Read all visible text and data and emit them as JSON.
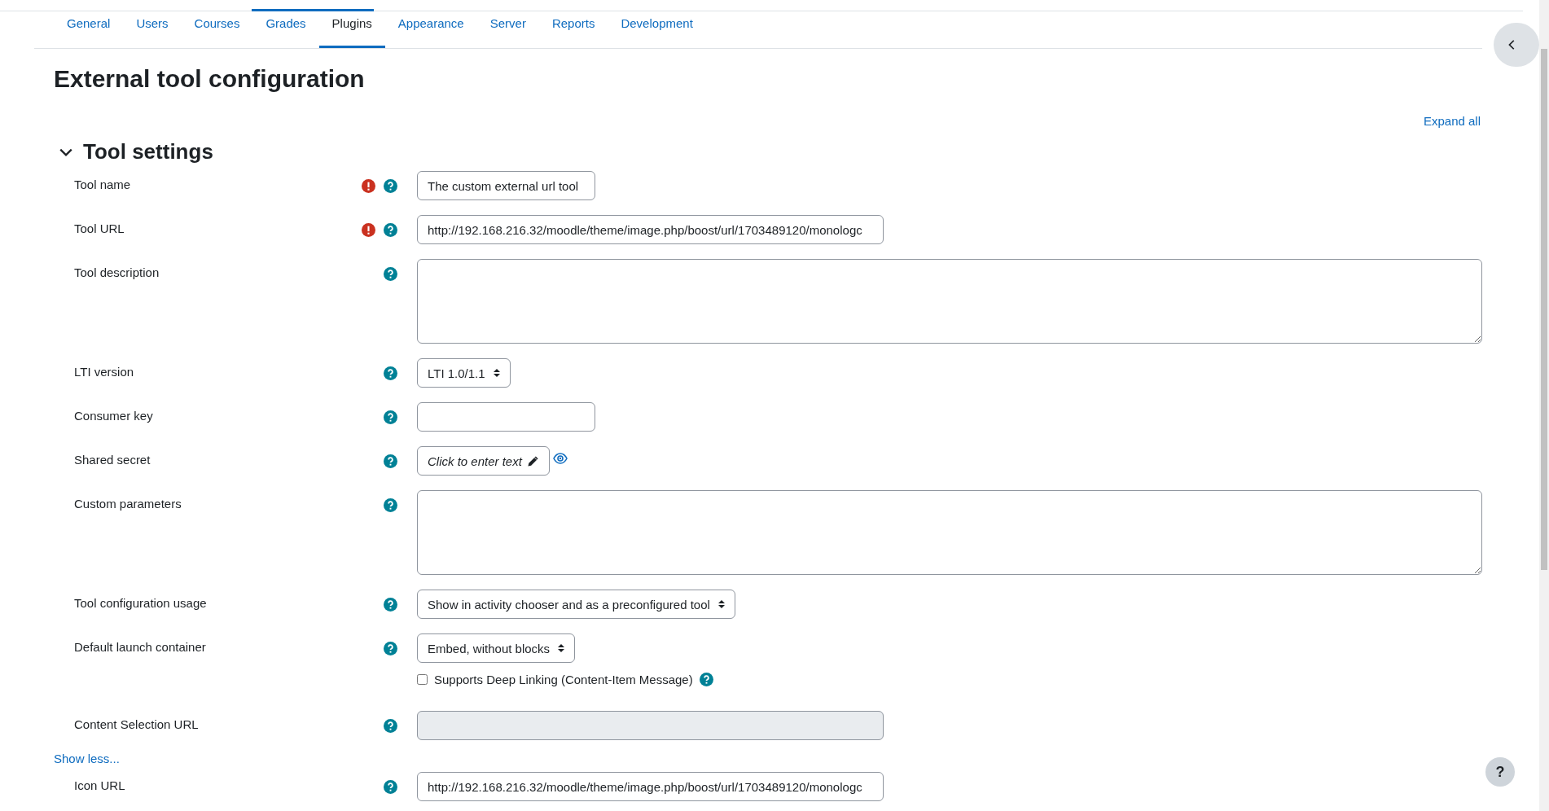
{
  "tabs": [
    {
      "label": "General",
      "selected": false
    },
    {
      "label": "Users",
      "selected": false
    },
    {
      "label": "Courses",
      "selected": false
    },
    {
      "label": "Grades",
      "selected": false
    },
    {
      "label": "Plugins",
      "selected": true
    },
    {
      "label": "Appearance",
      "selected": false
    },
    {
      "label": "Server",
      "selected": false
    },
    {
      "label": "Reports",
      "selected": false
    },
    {
      "label": "Development",
      "selected": false
    }
  ],
  "heading": "External tool configuration",
  "expand_all": "Expand all",
  "section": {
    "title": "Tool settings",
    "expanded": true
  },
  "fields": [
    {
      "kind": "text",
      "label": "Tool name",
      "required": true,
      "value": "The custom external url tool",
      "disabled": false
    },
    {
      "kind": "url",
      "label": "Tool URL",
      "required": true,
      "value": "http://192.168.216.32/moodle/theme/image.php/boost/url/1703489120/monologc",
      "disabled": false
    },
    {
      "kind": "textarea",
      "label": "Tool description",
      "required": false
    },
    {
      "kind": "select",
      "label": "LTI version",
      "required": false,
      "value": "LTI 1.0/1.1"
    },
    {
      "kind": "text",
      "label": "Consumer key",
      "required": false,
      "disabled": false
    },
    {
      "kind": "secret",
      "label": "Shared secret",
      "required": false,
      "value": "Click to enter text"
    },
    {
      "kind": "textarea",
      "label": "Custom parameters",
      "required": false
    },
    {
      "kind": "select",
      "label": "Tool configuration usage",
      "required": false,
      "value": "Show in activity chooser and as a preconfigured tool"
    },
    {
      "kind": "select",
      "label": "Default launch container",
      "required": false,
      "value": "Embed, without blocks"
    },
    {
      "kind": "checkbox",
      "label": "Supports Deep Linking (Content-Item Message)",
      "checked": false
    },
    {
      "kind": "url",
      "label": "Content Selection URL",
      "required": false,
      "disabled": true
    },
    {
      "kind": "link",
      "label": "Show less..."
    },
    {
      "kind": "url",
      "label": "Icon URL",
      "required": false,
      "value": "http://192.168.216.32/moodle/theme/image.php/boost/url/1703489120/monologc",
      "disabled": false
    }
  ],
  "help_button": "?"
}
